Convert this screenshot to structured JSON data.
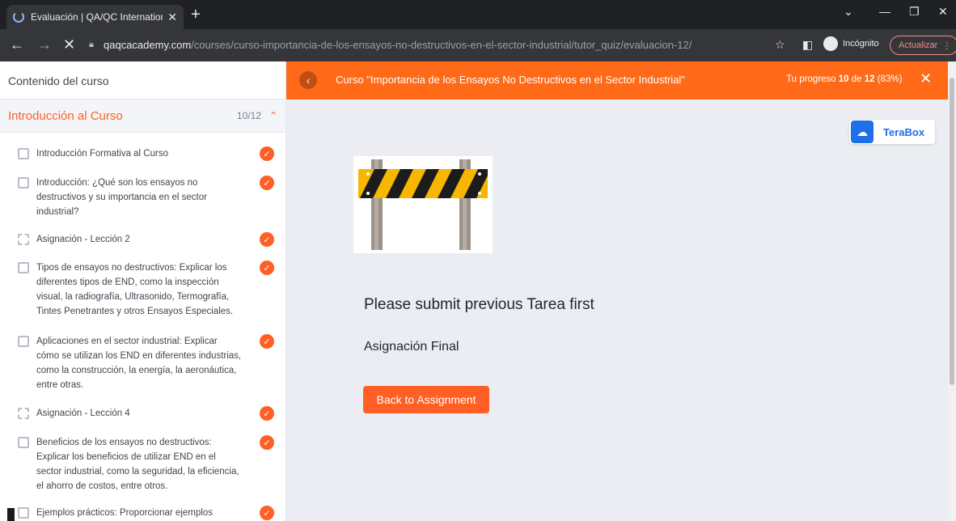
{
  "browser": {
    "tab_title": "Evaluación | QA/QC International",
    "url_host": "qaqcacademy.com",
    "url_path": "/courses/curso-importancia-de-los-ensayos-no-destructivos-en-el-sector-industrial/tutor_quiz/evaluacion-12/",
    "incognito_label": "Incógnito",
    "update_label": "Actualizar"
  },
  "sidebar": {
    "heading": "Contenido del curso",
    "topic": {
      "title": "Introducción al Curso",
      "count": "10/12"
    },
    "lessons": [
      {
        "label": "Introducción Formativa al Curso"
      },
      {
        "label": "Introducción: ¿Qué son los ensayos no destructivos y su importancia en el sector industrial?"
      },
      {
        "label": "Asignación - Lección 2"
      },
      {
        "label": "Tipos de ensayos no destructivos: Explicar los diferentes tipos de END, como la inspección visual, la radiografía, Ultrasonido, Termografía, Tintes Penetrantes y otros Ensayos Especiales."
      },
      {
        "label": "Aplicaciones en el sector industrial: Explicar cómo se utilizan los END en diferentes industrias, como la construcción, la energía, la aeronáutica, entre otras."
      },
      {
        "label": "Asignación - Lección 4"
      },
      {
        "label": "Beneficios de los ensayos no destructivos: Explicar los beneficios de utilizar END en el sector industrial, como la seguridad, la eficiencia, el ahorro de costos, entre otros."
      },
      {
        "label": "Ejemplos prácticos: Proporcionar ejemplos"
      }
    ]
  },
  "header": {
    "course_title": "Curso \"Importancia de los Ensayos No Destructivos en el Sector Industrial\"",
    "progress_prefix": "Tu progreso ",
    "progress_done": "10",
    "progress_of": " de ",
    "progress_total": "12",
    "progress_pct": " (83%)",
    "progress_value": 0.83
  },
  "main": {
    "terabox_label": "TeraBox",
    "message": "Please submit previous Tarea first",
    "assignment_title": "Asignación Final",
    "back_button": "Back to Assignment"
  }
}
